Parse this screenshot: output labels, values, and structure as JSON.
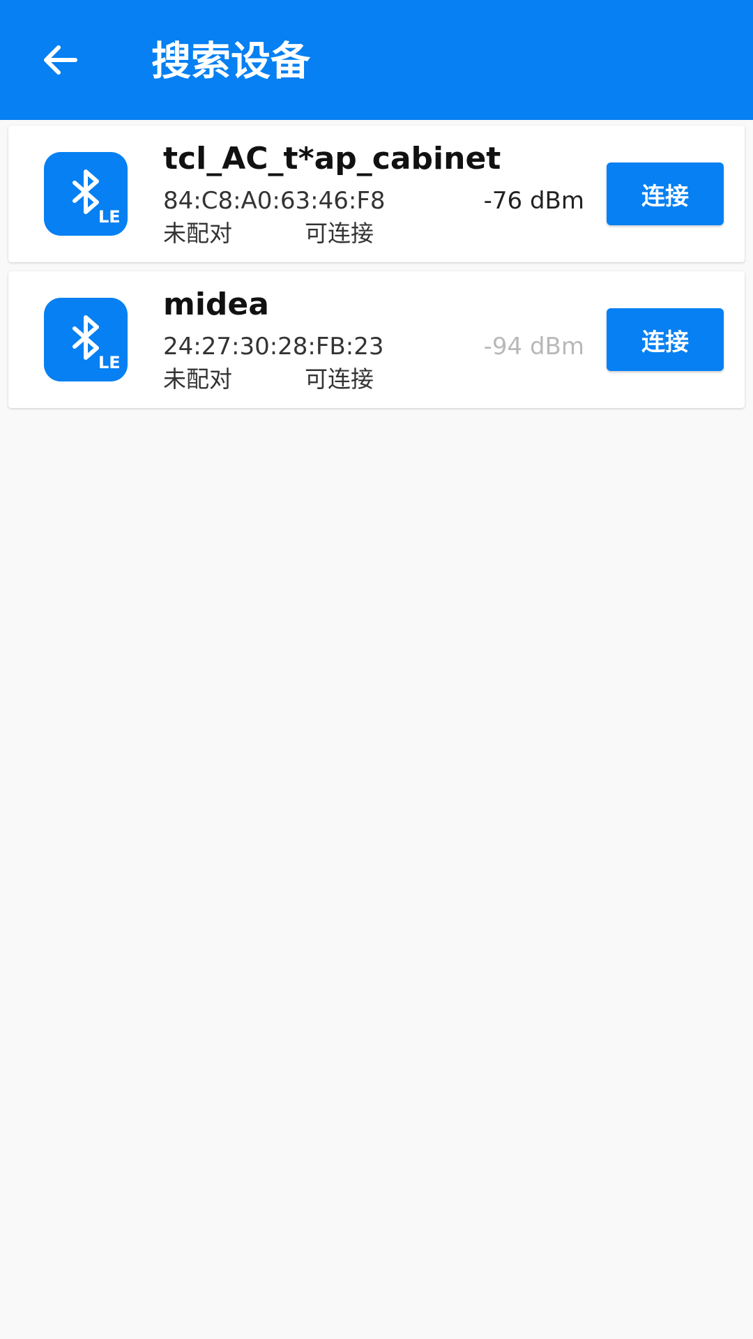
{
  "colors": {
    "accent": "#0680f2",
    "background": "#f9f9f9",
    "rssi_strong": "#222222",
    "rssi_weak": "#b8b8b8"
  },
  "toolbar": {
    "back_icon": "arrow-left-icon",
    "title": "搜索设备"
  },
  "devices": [
    {
      "icon": "bluetooth-le-icon",
      "icon_badge": "LE",
      "name": "tcl_AC_t*ap_cabinet",
      "mac": "84:C8:A0:63:46:F8",
      "rssi": "-76 dBm",
      "rssi_color": "#222222",
      "bond_state": "未配对",
      "connectable": "可连接",
      "button_label": "连接"
    },
    {
      "icon": "bluetooth-le-icon",
      "icon_badge": "LE",
      "name": "midea",
      "mac": "24:27:30:28:FB:23",
      "rssi": "-94 dBm",
      "rssi_color": "#b8b8b8",
      "bond_state": "未配对",
      "connectable": "可连接",
      "button_label": "连接"
    }
  ]
}
